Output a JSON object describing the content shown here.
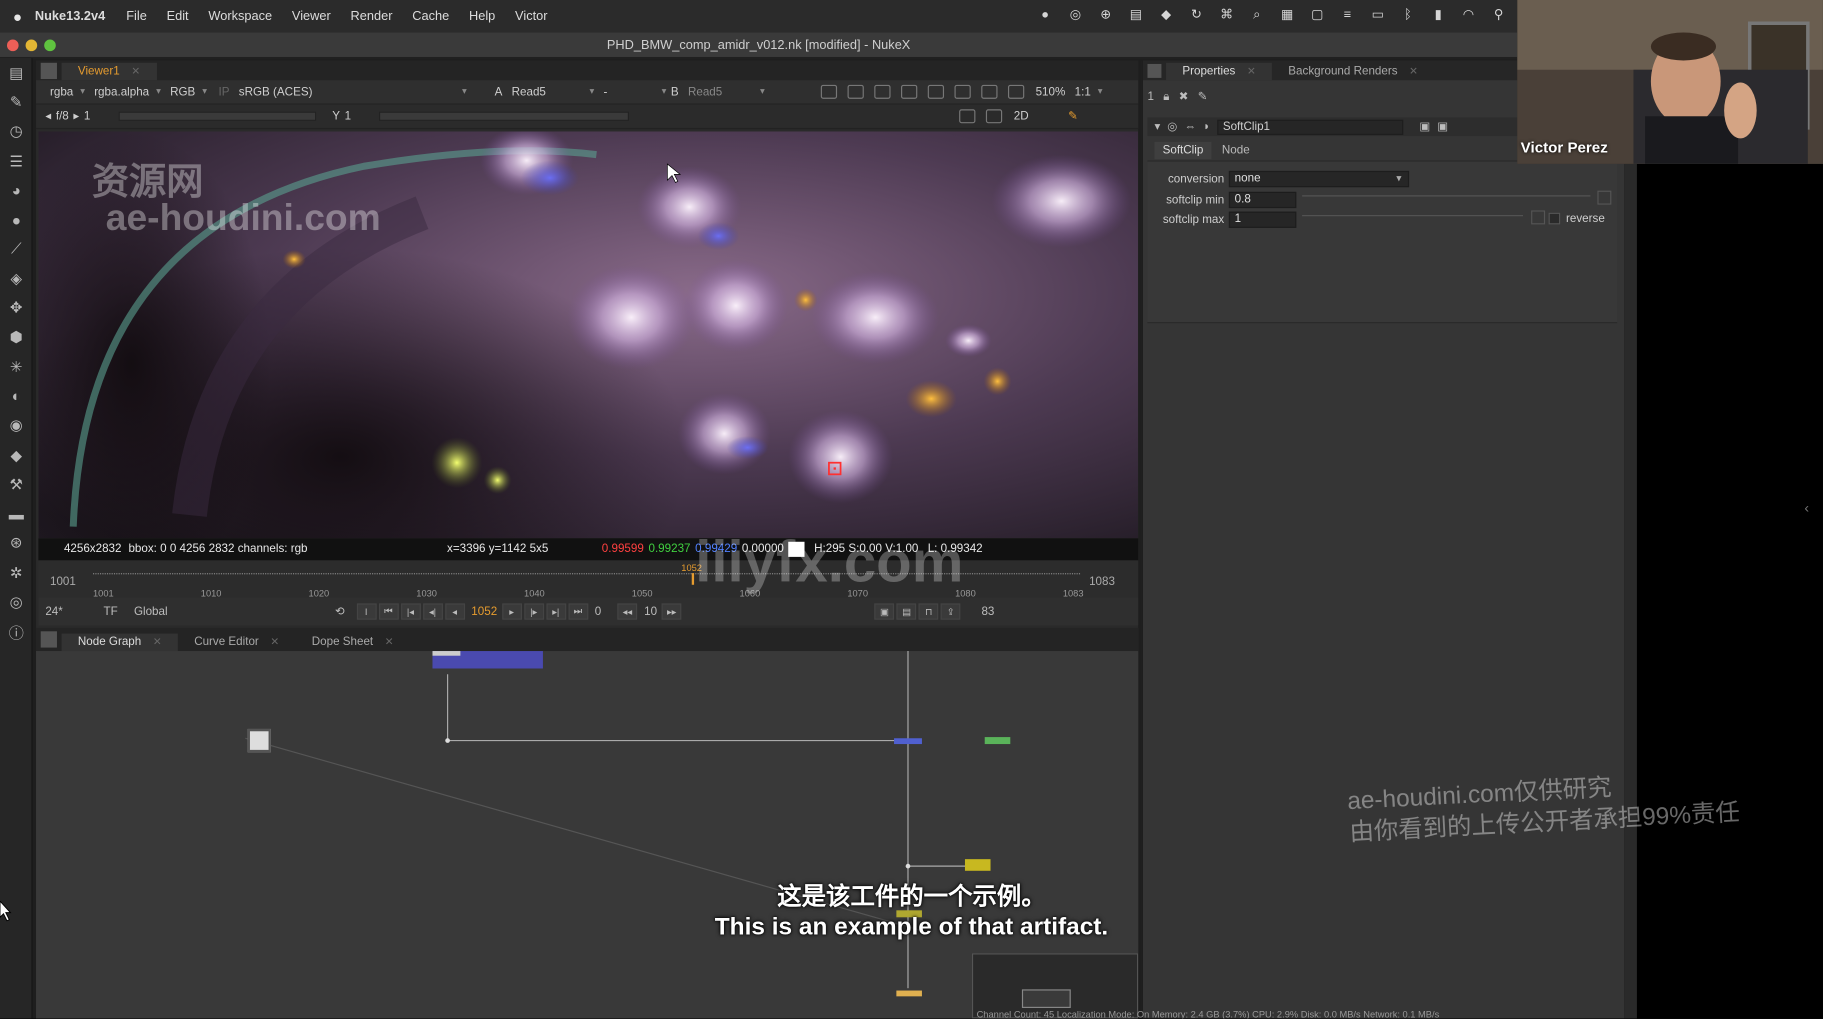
{
  "menubar": {
    "app_name": "Nuke13.2v4",
    "menus": [
      "File",
      "Edit",
      "Workspace",
      "Viewer",
      "Render",
      "Cache",
      "Help",
      "Victor"
    ]
  },
  "window": {
    "title": "PHD_BMW_comp_amidr_v012.nk [modified] - NukeX"
  },
  "viewer": {
    "tab_label": "Viewer1",
    "channels": "rgba",
    "alpha_channel": "rgba.alpha",
    "display_channels": "RGB",
    "ip_label": "IP",
    "colorspace": "sRGB (ACES)",
    "input_a_prefix": "A",
    "input_a": "Read5",
    "input_dash": "-",
    "input_b_prefix": "B",
    "input_b": "Read5",
    "zoom": "510%",
    "ratio": "1:1",
    "frame_fraction": "f/8",
    "frame_step": "1",
    "y_label": "Y",
    "y_value": "1",
    "view_mode": "2D",
    "info": {
      "format": "4256x2832",
      "bbox": "bbox: 0 0 4256 2832 channels: rgb",
      "coords": "x=3396 y=1142 5x5",
      "r": "0.99599",
      "g": "0.99237",
      "b": "0.99429",
      "a": "0.00000",
      "hsv": "H:295 S:0.00 V:1.00",
      "lum": "L: 0.99342"
    },
    "timeline": {
      "start": "1001",
      "end": "1083",
      "ticks": [
        "1001",
        "1010",
        "1020",
        "1030",
        "1040",
        "1050",
        "1060",
        "1070",
        "1080",
        "1083"
      ],
      "current_marker": "1052"
    },
    "playback": {
      "fps": "24*",
      "tf": "TF",
      "scope": "Global",
      "current_frame": "1052",
      "skip": "0",
      "increment": "10",
      "end_frame": "83"
    }
  },
  "nodegraph": {
    "tabs": [
      "Node Graph",
      "Curve Editor",
      "Dope Sheet"
    ]
  },
  "properties": {
    "tabs": [
      "Properties",
      "Background Renders"
    ],
    "max_panels": "1",
    "node_name": "SoftClip1",
    "node_tabs": [
      "SoftClip",
      "Node"
    ],
    "fields": {
      "conversion_label": "conversion",
      "conversion_value": "none",
      "softclip_min_label": "softclip min",
      "softclip_min_value": "0.8",
      "softclip_max_label": "softclip max",
      "softclip_max_value": "1",
      "reverse_label": "reverse"
    }
  },
  "webcam": {
    "name": "Victor Perez"
  },
  "watermarks": {
    "top_left_cn": "资源网",
    "top_left_url": "ae-houdini.com",
    "center": "iiiyfx.com",
    "right_line1": "ae-houdini.com仅供研究",
    "right_line2": "由你看到的上传公开者承担99%责任"
  },
  "subtitles": {
    "cn": "这是该工件的一个示例。",
    "en": "This is an example of that artifact."
  },
  "statusbar": {
    "text": "Channel Count: 45  Localization Mode: On  Memory: 2.4 GB (3.7%)  CPU: 2.9%  Disk: 0.0 MB/s  Network: 0.1 MB/s"
  },
  "colors": {
    "accent_orange": "#e69c2f",
    "node_blue": "#4a4ab0",
    "node_green": "#5ab35a",
    "node_yellow": "#c8b820",
    "node_orange": "#e0b050",
    "red_value": "#ff4040",
    "green_value": "#40d040",
    "blue_value": "#5080ff"
  }
}
